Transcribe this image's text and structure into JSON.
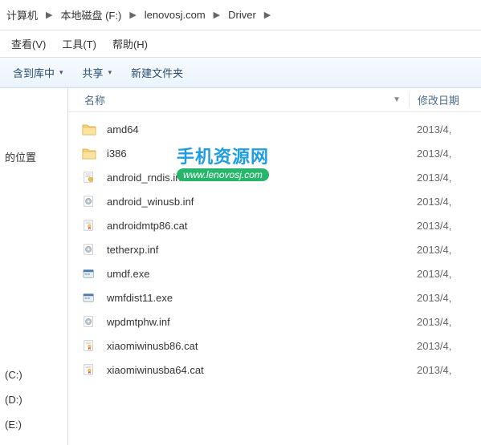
{
  "breadcrumb": {
    "items": [
      "计算机",
      "本地磁盘 (F:)",
      "lenovosj.com",
      "Driver"
    ]
  },
  "menubar": {
    "view": "查看(V)",
    "tools": "工具(T)",
    "help": "帮助(H)"
  },
  "toolbar": {
    "include": "含到库中",
    "share": "共享",
    "newfolder": "新建文件夹"
  },
  "sidebar": {
    "location": "的位置",
    "drives": [
      "(C:)",
      "(D:)",
      "(E:)"
    ]
  },
  "columns": {
    "name": "名称",
    "date": "修改日期"
  },
  "files": [
    {
      "name": "amd64",
      "type": "folder",
      "date": "2013/4,"
    },
    {
      "name": "i386",
      "type": "folder",
      "date": "2013/4,"
    },
    {
      "name": "android_rndis.inf",
      "type": "inf",
      "date": "2013/4,"
    },
    {
      "name": "android_winusb.inf",
      "type": "gear",
      "date": "2013/4,"
    },
    {
      "name": "androidmtp86.cat",
      "type": "cat",
      "date": "2013/4,"
    },
    {
      "name": "tetherxp.inf",
      "type": "gear",
      "date": "2013/4,"
    },
    {
      "name": "umdf.exe",
      "type": "exe",
      "date": "2013/4,"
    },
    {
      "name": "wmfdist11.exe",
      "type": "exe",
      "date": "2013/4,"
    },
    {
      "name": "wpdmtphw.inf",
      "type": "gear",
      "date": "2013/4,"
    },
    {
      "name": "xiaomiwinusb86.cat",
      "type": "cat",
      "date": "2013/4,"
    },
    {
      "name": "xiaomiwinusba64.cat",
      "type": "cat",
      "date": "2013/4,"
    }
  ],
  "watermark": {
    "title": "手机资源网",
    "url": "www.lenovosj.com"
  }
}
